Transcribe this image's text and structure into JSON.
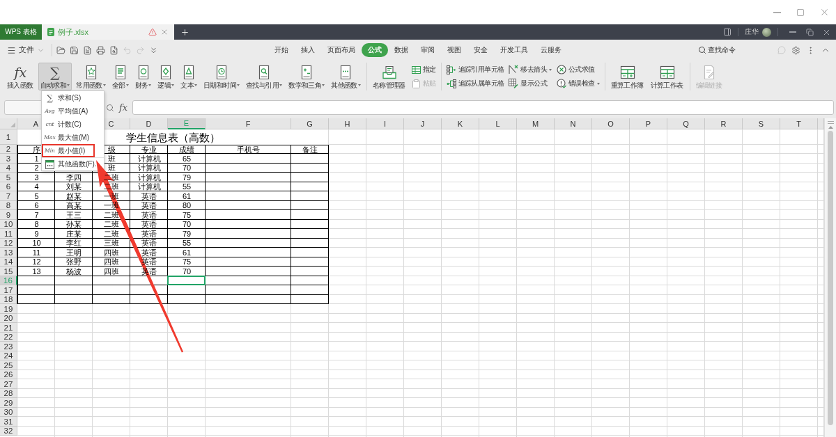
{
  "tab_bar": {
    "app": "WPS 表格",
    "documents": [
      {
        "title": "例子.xlsx",
        "selected": true,
        "warning": true
      }
    ],
    "user": "庄华"
  },
  "menu_bar": {
    "file": "文件",
    "quick_access": [
      {
        "disabled": false
      },
      {
        "disabled": false
      },
      {
        "disabled": false
      },
      {
        "disabled": false
      },
      {
        "disabled": false
      },
      {
        "disabled": true
      },
      {
        "disabled": true
      },
      {
        "disabled": false
      }
    ],
    "tabs": [
      {
        "label": "开始",
        "selected": false
      },
      {
        "label": "插入",
        "selected": false
      },
      {
        "label": "页面布局",
        "selected": false
      },
      {
        "label": "公式",
        "selected": true
      },
      {
        "label": "数据",
        "selected": false
      },
      {
        "label": "审阅",
        "selected": false
      },
      {
        "label": "视图",
        "selected": false
      },
      {
        "label": "安全",
        "selected": false
      },
      {
        "label": "开发工具",
        "selected": false
      },
      {
        "label": "云服务",
        "selected": false
      }
    ],
    "search": "查找命令"
  },
  "ribbon": {
    "groups": [
      {
        "items": [
          {
            "kind": "large",
            "symbol": "fx",
            "label": "插入函数",
            "dropdown": false,
            "expanded": false,
            "disabled": false
          },
          {
            "kind": "large",
            "symbol": "∑",
            "label": "自动求和",
            "dropdown": true,
            "expanded": true,
            "disabled": false,
            "menu": [
              {
                "symbol": "∑",
                "label": "求和(S)",
                "marked": false,
                "separated": false
              },
              {
                "symbol": "Avg",
                "label": "平均值(A)",
                "marked": false,
                "separated": false
              },
              {
                "symbol": "cnt",
                "label": "计数(C)",
                "marked": false,
                "separated": false
              },
              {
                "symbol": "Max",
                "label": "最大值(M)",
                "marked": false,
                "separated": false
              },
              {
                "symbol": "Min",
                "label": "最小值(I)",
                "marked": true,
                "separated": false
              },
              {
                "label": "其他函数(F).",
                "marked": false,
                "separated": true
              }
            ]
          },
          {
            "kind": "large",
            "label": "常用函数",
            "dropdown": true,
            "expanded": false,
            "disabled": false
          },
          {
            "kind": "large",
            "label": "全部",
            "dropdown": true,
            "expanded": false,
            "disabled": false
          },
          {
            "kind": "large",
            "label": "财务",
            "dropdown": true,
            "expanded": false,
            "disabled": false
          },
          {
            "kind": "large",
            "label": "逻辑",
            "dropdown": true,
            "expanded": false,
            "disabled": false
          },
          {
            "kind": "large",
            "label": "文本",
            "dropdown": true,
            "expanded": false,
            "disabled": false
          },
          {
            "kind": "large",
            "label": "日期和时间",
            "dropdown": true,
            "expanded": false,
            "disabled": false
          },
          {
            "kind": "large",
            "label": "查找与引用",
            "dropdown": true,
            "expanded": false,
            "disabled": false
          },
          {
            "kind": "large",
            "label": "数学和三角",
            "dropdown": true,
            "expanded": false,
            "disabled": false
          },
          {
            "kind": "large",
            "label": "其他函数",
            "dropdown": true,
            "expanded": false,
            "disabled": false
          }
        ]
      },
      {
        "items": [
          {
            "kind": "large",
            "label": "名称管理器",
            "dropdown": false,
            "expanded": false,
            "disabled": false
          },
          {
            "kind": "stack",
            "items": [
              {
                "label": "指定",
                "dropdown": false,
                "disabled": false
              },
              {
                "label": "粘贴",
                "dropdown": false,
                "disabled": true
              }
            ]
          }
        ]
      },
      {
        "items": [
          {
            "kind": "stack",
            "items": [
              {
                "label": "追踪引用单元格",
                "dropdown": false,
                "disabled": false
              },
              {
                "label": "追踪从属单元格",
                "dropdown": false,
                "disabled": false
              }
            ]
          },
          {
            "kind": "stack",
            "items": [
              {
                "label": "移去箭头",
                "dropdown": true,
                "disabled": false
              },
              {
                "label": "显示公式",
                "dropdown": false,
                "disabled": false
              }
            ]
          },
          {
            "kind": "stack",
            "items": [
              {
                "label": "公式求值",
                "dropdown": false,
                "disabled": false
              },
              {
                "label": "错误检查",
                "dropdown": true,
                "disabled": false
              }
            ]
          }
        ]
      },
      {
        "items": [
          {
            "kind": "large",
            "label": "重算工作簿",
            "dropdown": false,
            "expanded": false,
            "disabled": false
          },
          {
            "kind": "large",
            "label": "计算工作表",
            "dropdown": false,
            "expanded": false,
            "disabled": false
          }
        ]
      },
      {
        "items": [
          {
            "kind": "large",
            "label": "编辑链接",
            "dropdown": false,
            "expanded": false,
            "disabled": true
          }
        ]
      }
    ]
  },
  "formula_bar": {
    "function_button": "fx"
  },
  "sheet": {
    "columns": {
      "column_1": {
        "label": "A",
        "selected": false
      },
      "column_3": {
        "label": "C",
        "selected": false
      },
      "column_4": {
        "label": "D",
        "selected": false
      },
      "column_5": {
        "label": "E",
        "selected": true
      },
      "column_6": {
        "label": "F",
        "selected": false
      },
      "column_7": {
        "label": "G",
        "selected": false
      },
      "column_8": {
        "label": "H",
        "selected": false
      },
      "column_9": {
        "label": "I",
        "selected": false
      },
      "column_10": {
        "label": "J",
        "selected": false
      },
      "column_11": {
        "label": "K",
        "selected": false
      },
      "column_12": {
        "label": "L",
        "selected": false
      },
      "column_13": {
        "label": "M",
        "selected": false
      },
      "column_14": {
        "label": "N",
        "selected": false
      },
      "column_15": {
        "label": "O",
        "selected": false
      },
      "column_16": {
        "label": "P",
        "selected": false
      },
      "column_17": {
        "label": "Q",
        "selected": false
      },
      "column_18": {
        "label": "R",
        "selected": false
      },
      "column_19": {
        "label": "S",
        "selected": false
      },
      "column_20": {
        "label": "T",
        "selected": false
      }
    },
    "rows": [
      {
        "label": "1",
        "selected": false
      },
      {
        "label": "2",
        "selected": false
      },
      {
        "label": "3",
        "selected": false
      },
      {
        "label": "4",
        "selected": false
      },
      {
        "label": "5",
        "selected": false
      },
      {
        "label": "6",
        "selected": false
      },
      {
        "label": "7",
        "selected": false
      },
      {
        "label": "8",
        "selected": false
      },
      {
        "label": "9",
        "selected": false
      },
      {
        "label": "10",
        "selected": false
      },
      {
        "label": "11",
        "selected": false
      },
      {
        "label": "12",
        "selected": false
      },
      {
        "label": "13",
        "selected": false
      },
      {
        "label": "14",
        "selected": false
      },
      {
        "label": "15",
        "selected": false
      },
      {
        "label": "16",
        "selected": true
      },
      {
        "label": "17",
        "selected": false
      },
      {
        "label": "18",
        "selected": false
      },
      {
        "label": "19",
        "selected": false
      },
      {
        "label": "20",
        "selected": false
      },
      {
        "label": "21",
        "selected": false
      },
      {
        "label": "22",
        "selected": false
      },
      {
        "label": "23",
        "selected": false
      },
      {
        "label": "24",
        "selected": false
      },
      {
        "label": "25",
        "selected": false
      },
      {
        "label": "26",
        "selected": false
      },
      {
        "label": "27",
        "selected": false
      },
      {
        "label": "28",
        "selected": false
      },
      {
        "label": "29",
        "selected": false
      },
      {
        "label": "30",
        "selected": false
      },
      {
        "label": "31",
        "selected": false
      },
      {
        "label": "32",
        "selected": false
      }
    ],
    "table": {
      "title": "学生信息表（高数）",
      "header": {
        "column_1": "序",
        "column_3": "级",
        "column_4": "专业",
        "column_5": "成绩",
        "column_6": "手机号",
        "column_7": "备注"
      },
      "rows": [
        {
          "column_1": "1",
          "column_3": "班",
          "column_4": "计算机",
          "column_5": "65"
        },
        {
          "column_1": "2",
          "column_3": "班",
          "column_4": "计算机",
          "column_5": "70"
        },
        {
          "column_1": "3",
          "column_2": "李四",
          "column_3": "二班",
          "column_4": "计算机",
          "column_5": "79"
        },
        {
          "column_1": "4",
          "column_2": "刘某",
          "column_3": "二班",
          "column_4": "计算机",
          "column_5": "55"
        },
        {
          "column_1": "5",
          "column_2": "赵某",
          "column_3": "一班",
          "column_4": "英语",
          "column_5": "61"
        },
        {
          "column_1": "6",
          "column_2": "高某",
          "column_3": "一班",
          "column_4": "英语",
          "column_5": "80"
        },
        {
          "column_1": "7",
          "column_2": "王三",
          "column_3": "二班",
          "column_4": "英语",
          "column_5": "75"
        },
        {
          "column_1": "8",
          "column_2": "孙某",
          "column_3": "二班",
          "column_4": "英语",
          "column_5": "70"
        },
        {
          "column_1": "9",
          "column_2": "庄某",
          "column_3": "二班",
          "column_4": "英语",
          "column_5": "79"
        },
        {
          "column_1": "10",
          "column_2": "李红",
          "column_3": "三班",
          "column_4": "英语",
          "column_5": "55"
        },
        {
          "column_1": "11",
          "column_2": "王明",
          "column_3": "四班",
          "column_4": "英语",
          "column_5": "61"
        },
        {
          "column_1": "12",
          "column_2": "张野",
          "column_3": "四班",
          "column_4": "英语",
          "column_5": "75"
        },
        {
          "column_1": "13",
          "column_2": "杨波",
          "column_3": "四班",
          "column_4": "英语",
          "column_5": "70"
        }
      ]
    }
  }
}
